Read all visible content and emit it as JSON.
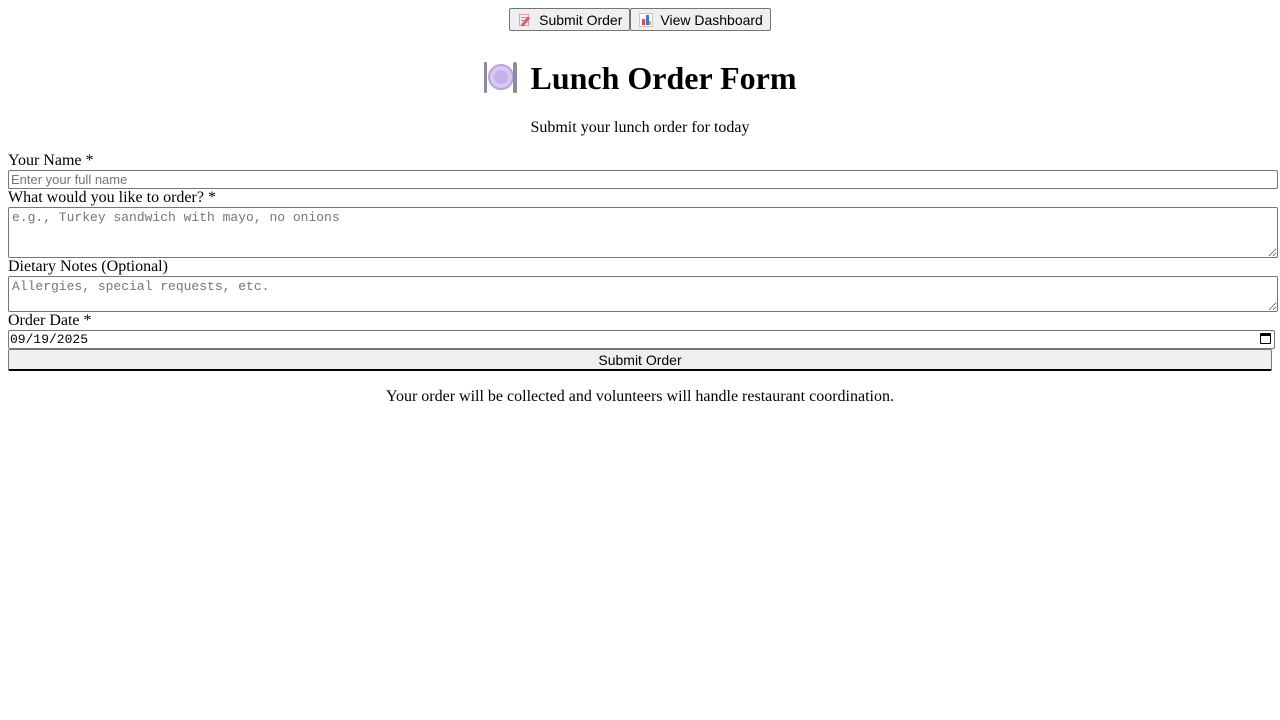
{
  "nav": {
    "submit_label": "Submit Order",
    "dashboard_label": "View Dashboard",
    "submit_icon": "memo-icon",
    "dashboard_icon": "bar-chart-icon"
  },
  "header": {
    "title": "Lunch Order Form",
    "title_icon": "plate-with-cutlery-icon",
    "subtitle": "Submit your lunch order for today"
  },
  "form": {
    "name_label": "Your Name *",
    "name_placeholder": "Enter your full name",
    "order_label": "What would you like to order? *",
    "order_placeholder": "e.g., Turkey sandwich with mayo, no onions",
    "notes_label": "Dietary Notes (Optional)",
    "notes_placeholder": "Allergies, special requests, etc.",
    "date_label": "Order Date *",
    "date_value": "09/19/2025",
    "submit_label": "Submit Order"
  },
  "footer": {
    "note": "Your order will be collected and volunteers will handle restaurant coordination."
  }
}
